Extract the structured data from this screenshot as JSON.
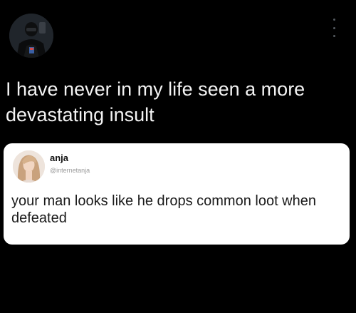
{
  "post": {
    "author_avatar": "user-avatar-photo",
    "more_icon": "more-options-icon",
    "text": "I have never in my life seen a more devastating insult"
  },
  "quoted_tweet": {
    "avatar": "user-avatar-photo",
    "name": "anja",
    "handle": "@internetanja",
    "text": "your man looks like he drops common loot when defeated"
  },
  "colors": {
    "background": "#000000",
    "card": "#ffffff",
    "text_dark": "#1a1a1a",
    "text_light": "#f3f3f3",
    "handle_gray": "#9a9a9a"
  }
}
